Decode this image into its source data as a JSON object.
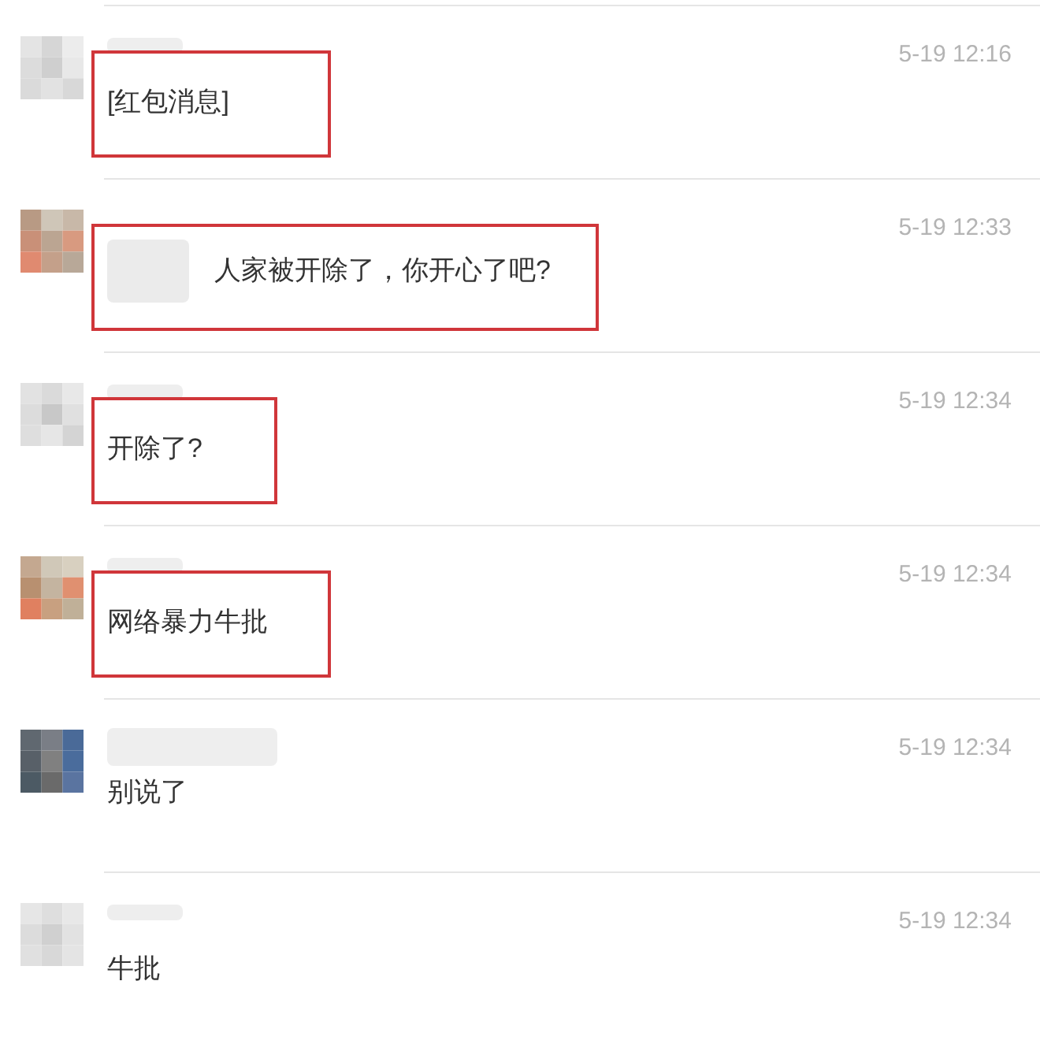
{
  "messages": [
    {
      "kind": "stacked",
      "time": "5-19 12:16",
      "text": "[红包消息]",
      "highlighted": true
    },
    {
      "kind": "inline",
      "time": "5-19 12:33",
      "text": "人家被开除了，你开心了吧?",
      "highlighted": true
    },
    {
      "kind": "stacked",
      "time": "5-19 12:34",
      "text": "开除了?",
      "highlighted": true
    },
    {
      "kind": "stacked",
      "time": "5-19 12:34",
      "text": "网络暴力牛批",
      "highlighted": true
    },
    {
      "kind": "tall",
      "time": "5-19 12:34",
      "text": "别说了",
      "highlighted": false
    },
    {
      "kind": "stacked",
      "time": "5-19 12:34",
      "text": "牛批",
      "highlighted": false
    }
  ]
}
